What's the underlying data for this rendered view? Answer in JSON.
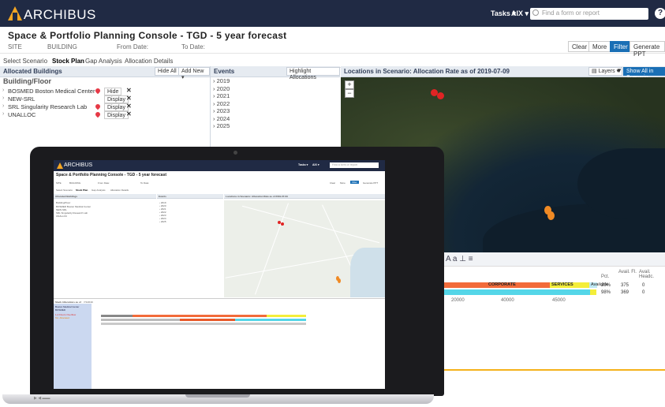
{
  "app": {
    "logo_text": "ARCHIBUS",
    "tasks_label": "Tasks",
    "user_label": "AIX",
    "search_placeholder": "Find a form or report",
    "help_label": "?"
  },
  "page": {
    "title": "Space & Portfolio Planning Console - TGD - 5 year forecast"
  },
  "filters": {
    "site_label": "SITE",
    "building_label": "BUILDING",
    "from_date_label": "From Date:",
    "to_date_label": "To Date:",
    "buttons": [
      "Clear",
      "More",
      "Filter",
      "Generate PPT"
    ]
  },
  "tabs": [
    "Select Scenario",
    "Stock Plan",
    "Gap Analysis",
    "Allocation Details"
  ],
  "allocated_buildings": {
    "title": "Allocated Buildings",
    "hide_all": "Hide All",
    "add_new": "Add New",
    "column_header": "Building/Floor",
    "rows": [
      {
        "name": "BOSMED Boston Medical Center",
        "action": "Hide"
      },
      {
        "name": "NEW-SRL",
        "action": ""
      },
      {
        "name": "SRL Singularity Research Lab",
        "action": "Display"
      },
      {
        "name": "UNALLOC",
        "action": "Display"
      }
    ],
    "first_row_display": "Display"
  },
  "events": {
    "title": "Events",
    "highlight": "Highlight Allocations",
    "years": [
      "2019",
      "2020",
      "2021",
      "2022",
      "2023",
      "2024",
      "2025"
    ]
  },
  "map": {
    "title": "Locations in Scenario: Allocation Rate as of 2019-07-09",
    "layers_label": "Layers",
    "show_all": "Show All in Scenario",
    "zoom_in": "+",
    "zoom_out": "−"
  },
  "lower_right": {
    "tools": "A a ⊥ ≡",
    "col_headers": [
      "Avail. Fl.",
      "Avail. Headc.",
      "Pct."
    ],
    "bar_labels": [
      "CORPORATE",
      "SERVICES",
      "Available"
    ],
    "values": [
      "20%",
      "375",
      "0",
      "98%",
      "369",
      "0"
    ],
    "axis": [
      "20000",
      "40000",
      "45000"
    ]
  },
  "laptop": {
    "base_left": "▶ ◀ ▬▬",
    "lower_title": "Stack Allocations as of",
    "lower_date": "7/1/2019",
    "lower_building": "Boston Medical Center",
    "lower_sub": "BOSMED",
    "lower_red": "1-2 Floors Overflow",
    "lower_orange": "Tot. Allocated"
  }
}
